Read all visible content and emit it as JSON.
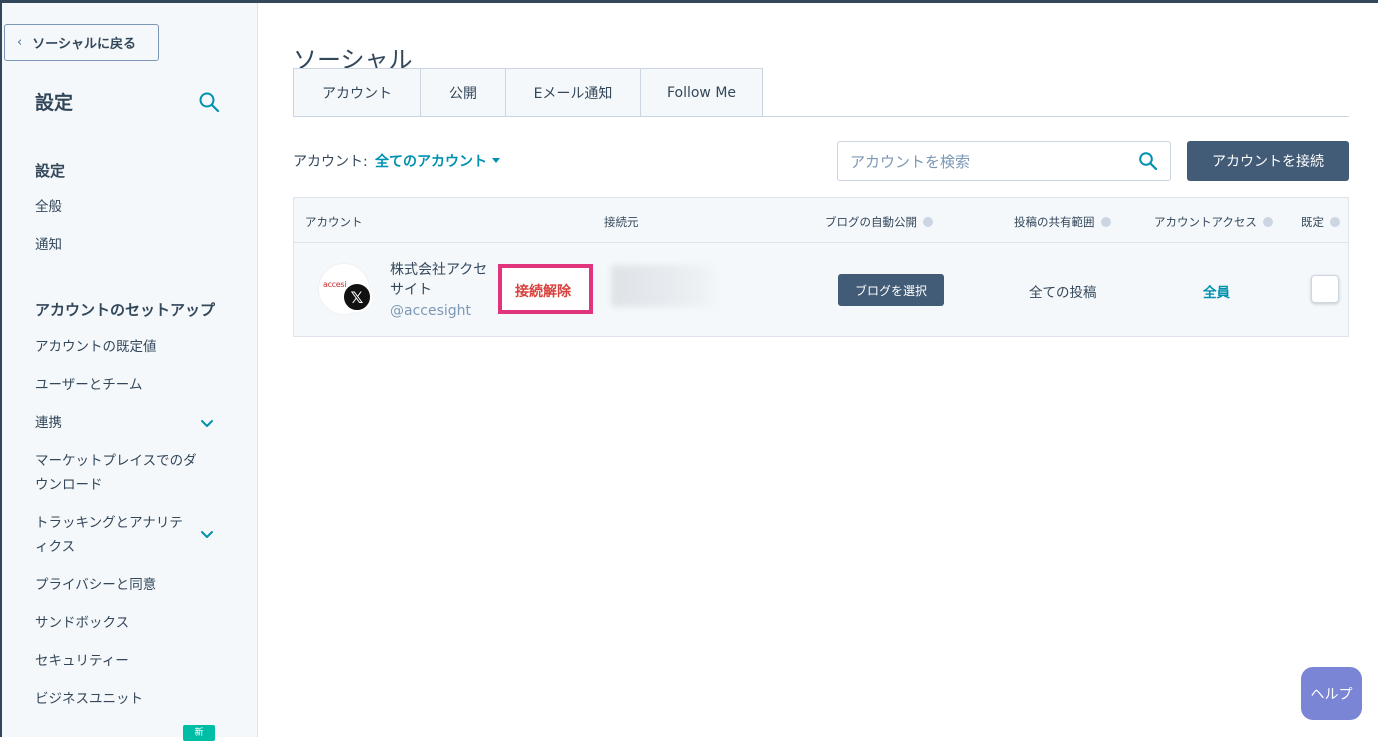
{
  "sidebar": {
    "back_label": "ソーシャルに戻る",
    "title": "設定",
    "section_settings": "設定",
    "items_settings": [
      "全般",
      "通知"
    ],
    "section_account": "アカウントのセットアップ",
    "items_account": [
      "アカウントの既定値",
      "ユーザーとチーム",
      "連携",
      "マーケットプレイスでのダウンロード",
      "トラッキングとアナリティクス",
      "プライバシーと同意",
      "サンドボックス",
      "セキュリティー",
      "ビジネスユニット"
    ],
    "new_badge": "新"
  },
  "page": {
    "title": "ソーシャル",
    "tabs": [
      "アカウント",
      "公開",
      "Eメール通知",
      "Follow Me"
    ]
  },
  "filter": {
    "label": "アカウント:",
    "value": "全てのアカウント"
  },
  "search": {
    "placeholder": "アカウントを検索"
  },
  "connect_button": "アカウントを接続",
  "table": {
    "headers": [
      "アカウント",
      "接続元",
      "ブログの自動公開",
      "投稿の共有範囲",
      "アカウントアクセス",
      "既定"
    ],
    "row": {
      "logo_text": "accesi",
      "network_glyph": "𝕏",
      "name": "株式会社アクセサイト",
      "handle": "@accesight",
      "disconnect": "接続解除",
      "blog_button": "ブログを選択",
      "scope": "全ての投稿",
      "access": "全員"
    }
  },
  "help_button": "ヘルプ",
  "colors": {
    "primary_dark": "#425b76",
    "link": "#0091ae",
    "highlight": "#e0357d",
    "danger_text": "#d9413d",
    "help": "#7b85d6"
  }
}
